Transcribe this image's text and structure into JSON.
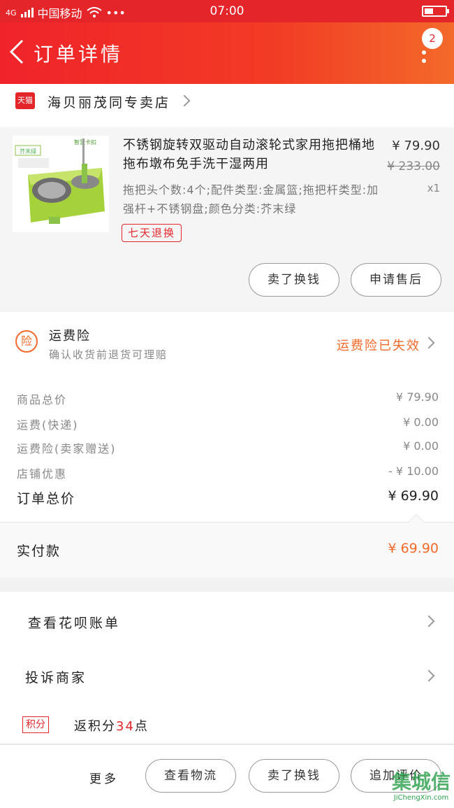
{
  "status_bar": {
    "network": "4G",
    "carrier": "中国移动",
    "dots": "•••",
    "time": "07:00"
  },
  "header": {
    "title": "订单详情",
    "badge": "2"
  },
  "shop": {
    "badge": "天猫",
    "name": "海贝丽茂同专卖店"
  },
  "product": {
    "image_labels": {
      "brand": "芥末绿",
      "tag": "智慧卡扣"
    },
    "title": "不锈钢旋转双驱动自动滚轮式家用拖把桶地拖布墩布免手洗干湿两用",
    "price": "¥ 79.90",
    "original_price": "¥ 233.00",
    "quantity": "x1",
    "specs": "拖把头个数:4个;配件类型:金属篮;拖把杆类型:加强杆+不锈钢盘;颜色分类:芥末绿",
    "return_tag": "七天退换",
    "buttons": [
      "卖了换钱",
      "申请售后"
    ]
  },
  "insurance": {
    "icon_char": "险",
    "title": "运费险",
    "subtitle": "确认收货前退货可理赔",
    "status": "运费险已失效"
  },
  "costs": [
    {
      "label": "商品总价",
      "value": "¥ 79.90"
    },
    {
      "label": "运费(快递)",
      "value": "¥ 0.00"
    },
    {
      "label": "运费险(卖家赠送)",
      "value": "¥ 0.00"
    },
    {
      "label": "店铺优惠",
      "value": "- ¥ 10.00"
    },
    {
      "label": "订单总价",
      "value": "¥ 69.90"
    }
  ],
  "paid": {
    "label": "实付款",
    "value": "¥ 69.90"
  },
  "links": [
    "查看花呗账单",
    "投诉商家"
  ],
  "points": {
    "tag": "积分",
    "prefix": "返积分",
    "number": "34",
    "suffix": "点"
  },
  "bottom_bar": {
    "more": "更多",
    "buttons": [
      "查看物流",
      "卖了换钱",
      "追加评价"
    ]
  },
  "watermark": {
    "text": "集城信",
    "url": "JiChengXin.com"
  },
  "colors": {
    "brand_red": "#e4262b",
    "accent_orange": "#f36a2a",
    "lime": "#8bc34a"
  }
}
